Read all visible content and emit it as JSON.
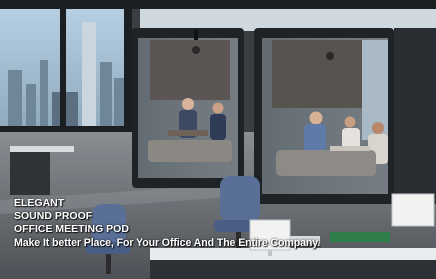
{
  "photo": {
    "subject": "office meeting pod scene",
    "colors": {
      "pod_frame": "#1f2326",
      "pod_panel": "#4e4a47",
      "glass": "#7c8690",
      "sky": "#9fc0d8",
      "floor": "#6d7177",
      "chair_blue": "#5a6f98",
      "desk_white": "#e9ecef"
    }
  },
  "caption": {
    "line1": "ELEGANT",
    "line2": "SOUND PROOF",
    "line3": "OFFICE MEETING POD",
    "line4": "Make It better Place, For Your Office And The Entire Company."
  }
}
